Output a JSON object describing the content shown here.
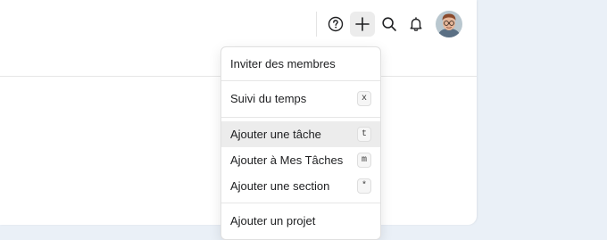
{
  "toolbar": {
    "icons": [
      "help-icon",
      "plus-icon",
      "search-icon",
      "bell-icon"
    ],
    "avatar_alt": "avatar"
  },
  "menu": {
    "items": [
      {
        "label": "Inviter des membres",
        "shortcut": ""
      },
      {
        "label": "Suivi du temps",
        "shortcut": "x"
      },
      {
        "label": "Ajouter une tâche",
        "shortcut": "t"
      },
      {
        "label": "Ajouter à Mes Tâches",
        "shortcut": "m"
      },
      {
        "label": "Ajouter une section",
        "shortcut": "*"
      },
      {
        "label": "Ajouter un projet",
        "shortcut": ""
      }
    ]
  },
  "colors": {
    "background": "#eaf0f7",
    "panel": "#ffffff",
    "hover": "#ececec",
    "text": "#1e1f21"
  }
}
